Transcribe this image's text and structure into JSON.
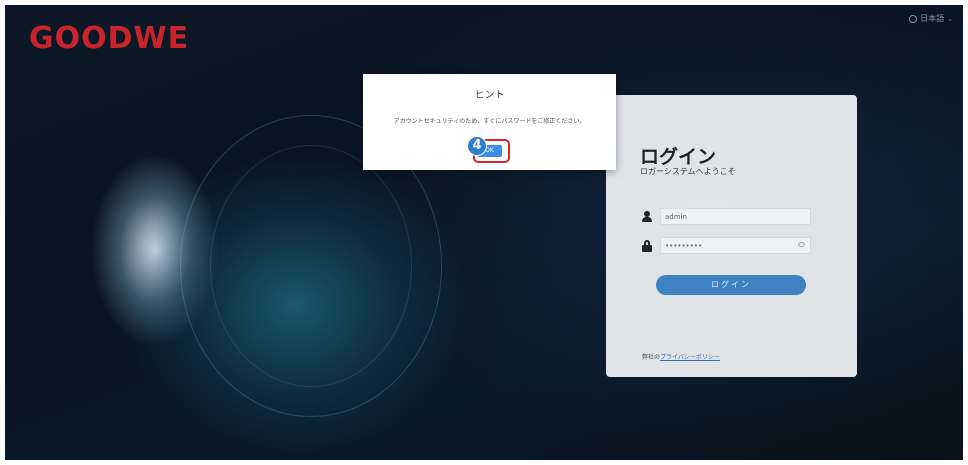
{
  "brand": {
    "logo_text": "GOODWE",
    "logo_color": "#c8252b"
  },
  "header": {
    "language_label": "日本語",
    "language_icon": "globe-icon",
    "language_chevron": "chevron-down-icon"
  },
  "modal": {
    "title": "ヒント",
    "message": "アカウントセキュリティのため、すぐにパスワードをご修正ください。",
    "ok_label": "OK",
    "step_number": "4",
    "highlight_color": "#d8242b",
    "button_color": "#3a8ee6"
  },
  "login": {
    "title": "ログイン",
    "subtitle": "ロガーシステムへようこそ",
    "username_value": "admin",
    "username_icon": "user-icon",
    "password_value": "•••••••••",
    "password_icon": "lock-icon",
    "password_toggle_icon": "eye-icon",
    "submit_label": "ログイン",
    "submit_color": "#3d83c4",
    "privacy_prefix": "弊社の",
    "privacy_link": "プライバシーポリシー"
  }
}
